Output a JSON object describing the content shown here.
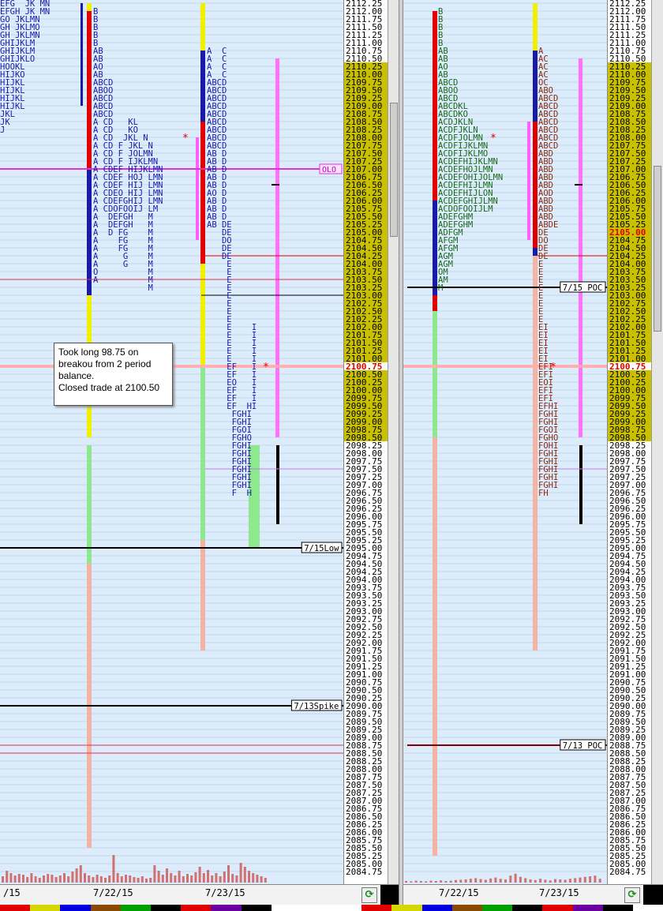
{
  "chart_data": {
    "type": "market profile",
    "price_ticks": [
      "2112.25",
      "2112.00",
      "2111.75",
      "2111.50",
      "2111.25",
      "2111.00",
      "2110.75",
      "2110.50",
      "2110.25",
      "2110.00",
      "2109.75",
      "2109.50",
      "2109.25",
      "2109.00",
      "2108.75",
      "2108.50",
      "2108.25",
      "2108.00",
      "2107.75",
      "2107.50",
      "2107.25",
      "2107.00",
      "2106.75",
      "2106.50",
      "2106.25",
      "2106.00",
      "2105.75",
      "2105.50",
      "2105.25",
      "2105.00",
      "2104.75",
      "2104.50",
      "2104.25",
      "2104.00",
      "2103.75",
      "2103.50",
      "2103.25",
      "2103.00",
      "2102.75",
      "2102.50",
      "2102.25",
      "2102.00",
      "2101.75",
      "2101.50",
      "2101.25",
      "2101.00",
      "2100.75",
      "2100.50",
      "2100.25",
      "2100.00",
      "2099.75",
      "2099.50",
      "2099.25",
      "2099.00",
      "2098.75",
      "2098.50",
      "2098.25",
      "2098.00",
      "2097.75",
      "2097.50",
      "2097.25",
      "2097.00",
      "2096.75",
      "2096.50",
      "2096.25",
      "2096.00",
      "2095.75",
      "2095.50",
      "2095.25",
      "2095.00",
      "2094.75",
      "2094.50",
      "2094.25",
      "2094.00",
      "2093.75",
      "2093.50",
      "2093.25",
      "2093.00",
      "2092.75",
      "2092.50",
      "2092.25",
      "2092.00",
      "2091.75",
      "2091.50",
      "2091.25",
      "2091.00",
      "2090.75",
      "2090.50",
      "2090.25",
      "2090.00",
      "2089.75",
      "2089.50",
      "2089.25",
      "2089.00",
      "2088.75",
      "2088.50",
      "2088.25",
      "2088.00",
      "2087.75",
      "2087.50",
      "2087.25",
      "2087.00",
      "2086.75",
      "2086.50",
      "2086.25",
      "2086.00",
      "2085.75",
      "2085.50",
      "2085.25",
      "2085.00",
      "2084.75"
    ],
    "tick_step": 0.25,
    "highlight_price": "2100.75",
    "highlight_price_right": "2105.00",
    "reference_levels": [
      {
        "label": "7/15Low",
        "price": 2095.0,
        "pane": "left"
      },
      {
        "label": "7/13Spike",
        "price": 2090.0,
        "pane": "left"
      },
      {
        "label": "OLO",
        "price": 2107.0,
        "pane": "left"
      },
      {
        "label": "7/15 POC",
        "price": 2103.25,
        "pane": "right"
      },
      {
        "label": "7/13 POC",
        "price": 2088.75,
        "pane": "right"
      }
    ],
    "dates_left": [
      "/15",
      "7/22/15",
      "7/23/15"
    ],
    "dates_right": [
      "7/22/15",
      "7/23/15"
    ],
    "annotation": "Took long 98.75 on\nbreakou from 2 period\nbalance.\nClosed trade at 2100.50",
    "profiles": {
      "left_a": {
        "top": 2112.25,
        "rows": [
          "EFG  JK MN",
          "EFGH JK MN",
          "GO JKLMN",
          "GH JKLMO",
          "GH JKLMN",
          "GHIJKLM",
          "GHIJKLM",
          "GHIJKLO",
          "HOOKL",
          "HIJKO",
          "HIJKL",
          "HIJKL",
          "HIJKL",
          "HIJKL",
          "JKL",
          "JK",
          "J"
        ]
      },
      "left_b": {
        "top": 2112.0,
        "rows": [
          "B",
          "B",
          "B",
          "B",
          "B",
          "AB",
          "AB",
          "AO",
          "AB",
          "ABCD",
          "ABOO",
          "ABCD",
          "ABCD",
          "ABCD",
          "A CD   KL",
          "A CD   KO",
          "A CD  JKL N",
          "A CD F JKL N",
          "A CD F JOLMN",
          "A CD F IJKLMN",
          "A CDEF HIJKLMN",
          "A CDEF HOJ LMN",
          "A CDEF HIJ LMN",
          "A CDEO HIJ LMN",
          "A CDEFGHIJ LMN",
          "A CDOFOOIJ LM",
          "A  DEFGH   M",
          "A  DEFGH   M",
          "A  D FG    M",
          "A    FG    M",
          "A    FG    M",
          "A     G    M",
          "A     G    M",
          "O          M",
          "A          M",
          "           M"
        ]
      },
      "left_c": {
        "top": 2110.75,
        "rows": [
          "A  C",
          "A  C",
          "A  C",
          "A  C",
          "ABCD",
          "ABCD",
          "ABCD",
          "ABCD",
          "ABCD",
          "ABCD",
          "ABCD",
          "ABCD",
          "ABCD",
          "AB D",
          "AB D",
          "AB D",
          "AB D",
          "AB D",
          "AO D",
          "AB D",
          "AB D",
          "AB D",
          "AB DE",
          "   DE",
          "   DO",
          "   DE",
          "   DE",
          "    E",
          "    E",
          "    E",
          "    E",
          "    E",
          "    E",
          "    E",
          "    E",
          "    E    I",
          "    E    I",
          "    E    I",
          "    E    I",
          "    E    I",
          "    EF   I",
          "    EF   I",
          "    EO   I",
          "    EF   I",
          "    EF   I",
          "    EF  HI",
          "     FGHI",
          "     FGHI",
          "     FGOI",
          "     FGHO",
          "     FGHI",
          "     FGHI",
          "     FGHI",
          "     FGHI",
          "     FGHI",
          "     FGHI",
          "     F  H"
        ]
      },
      "right_a": {
        "top": 2112.0,
        "rows": [
          "B",
          "B",
          "B",
          "B",
          "B",
          "AB",
          "AB",
          "AO",
          "AB",
          "ABCD",
          "ABOO",
          "ABCD",
          "ABCDKL",
          "ABCDKO",
          "ACDJKLN",
          "ACDFJKLN",
          "ACDFJOLMN",
          "ACDFIJKLMN",
          "ACDFIJKLMO",
          "ACDEFHIJKLMN",
          "ACDEFHOJLMN",
          "ACDEFOHIJOLMN",
          "ACDEFHIJLMN",
          "ACDEFHIJLON",
          "ACDEFGHIJLMN",
          "ACDOFOOIJLM",
          "ADEFGHM",
          "ADEFGHM",
          "ADFGM",
          "AFGM",
          "AFGM",
          "AGM",
          "AGM",
          "OM",
          "AM",
          "M"
        ]
      },
      "right_b": {
        "top": 2110.75,
        "rows": [
          "A",
          "AC",
          "AC",
          "AC",
          "OC",
          "ABO",
          "ABCD",
          "ABCD",
          "ABCD",
          "ABCD",
          "ABCD",
          "ABCD",
          "ABCD",
          "ABD",
          "ABD",
          "ABD",
          "ABD",
          "ABD",
          "AOD",
          "ABD",
          "ABD",
          "ABD",
          "ABDE",
          "DE",
          "DO",
          "DE",
          "DE",
          "E",
          "E",
          "E",
          "E",
          "E",
          "E",
          "E",
          "E",
          "EI",
          "EI",
          "EI",
          "EI",
          "EI",
          "EFI",
          "EFI",
          "EOI",
          "EFI",
          "EFI",
          "EFHI",
          "FGHI",
          "FGHI",
          "FGOI",
          "FGHO",
          "FOHI",
          "FGHI",
          "FGHI",
          "FGHI",
          "FGHI",
          "FGHI",
          "FH"
        ]
      }
    },
    "volume": {
      "left": [
        8,
        15,
        12,
        9,
        11,
        10,
        7,
        12,
        8,
        6,
        9,
        11,
        10,
        7,
        9,
        12,
        8,
        14,
        18,
        22,
        12,
        9,
        7,
        10,
        8,
        6,
        9,
        35,
        12,
        8,
        10,
        9,
        7,
        6,
        8,
        5,
        6,
        22,
        15,
        10,
        18,
        12,
        9,
        15,
        8,
        11,
        9,
        13,
        20,
        12,
        16,
        9,
        12,
        8,
        14,
        22,
        11,
        9,
        25,
        20,
        15,
        12,
        10,
        8,
        6
      ],
      "right": [
        5,
        4,
        6,
        5,
        4,
        6,
        5,
        7,
        5,
        6,
        8,
        9,
        10,
        12,
        14,
        11,
        9,
        13,
        16,
        12,
        10,
        22,
        28,
        18,
        14,
        10,
        8,
        12,
        9,
        7,
        11,
        10,
        9,
        12,
        14,
        16,
        18,
        20,
        22,
        12
      ]
    }
  }
}
